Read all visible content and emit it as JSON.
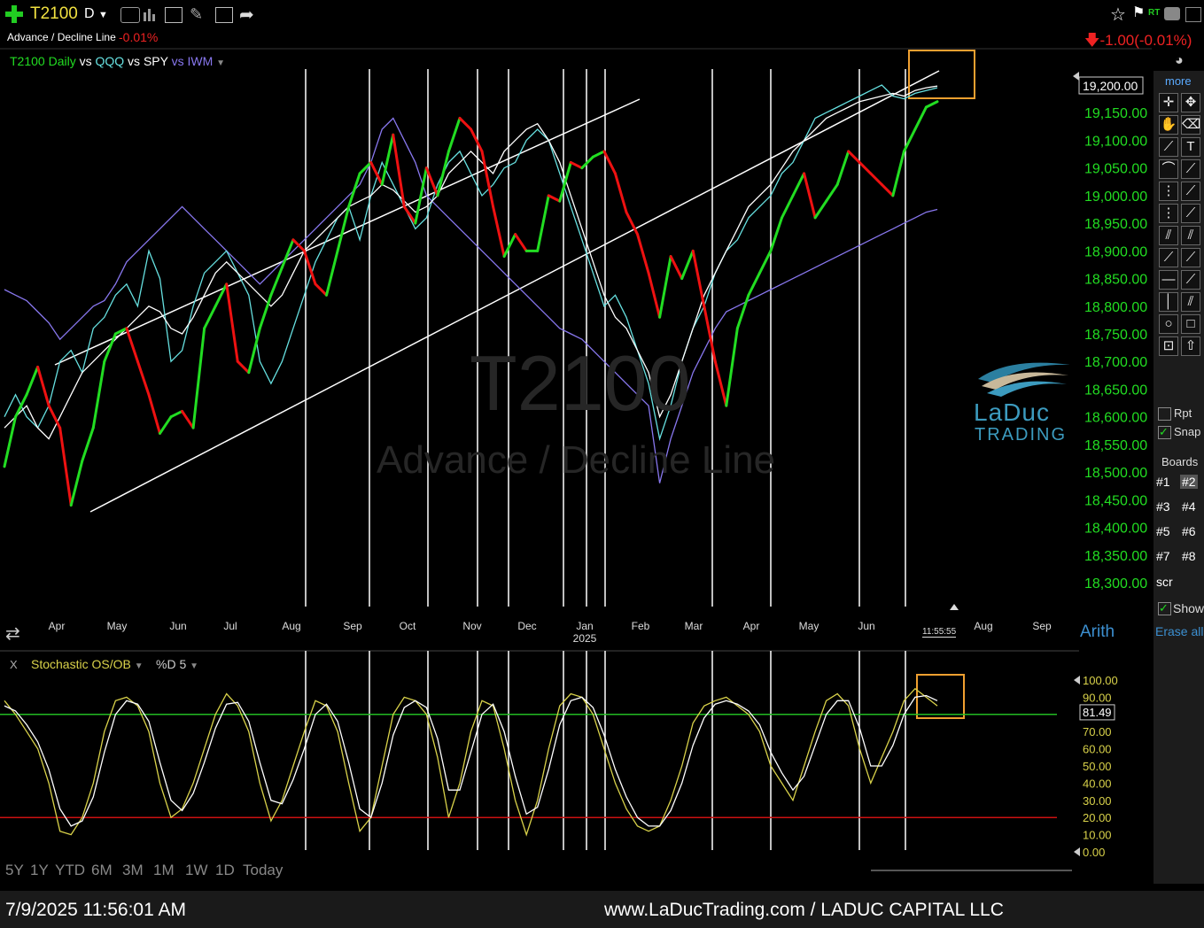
{
  "header": {
    "symbol": "T2100",
    "period": "D",
    "subtitle": "Advance / Decline Line",
    "change_pct": "-0.01%",
    "right_change": "-1.00",
    "right_change_pct": "(-0.01%)",
    "rt_label": "RT",
    "compare_line": {
      "t2100": "T2100 Daily",
      "vs1": "vs",
      "qqq": "QQQ",
      "vs2": "vs",
      "spy": "SPY",
      "vs3": "vs",
      "iwm": "IWM"
    }
  },
  "watermark": {
    "line1": "T2100",
    "line2": "Advance / Decline Line"
  },
  "logo": {
    "line1": "LaDuc",
    "line2": "TRADING"
  },
  "right_panel": {
    "more": "more",
    "rpt": "Rpt",
    "snap": "Snap",
    "boards_title": "Boards",
    "boards": [
      "#1",
      "#2",
      "#3",
      "#4",
      "#5",
      "#6",
      "#7",
      "#8"
    ],
    "scr": "scr",
    "show": "Show",
    "erase": "Erase all",
    "arith": "Arith"
  },
  "time_label": "11:55:55",
  "indicator": {
    "close": "X",
    "name": "Stochastic OS/OB",
    "param": "%D 5",
    "current": "81.49"
  },
  "ranges": [
    "5Y",
    "1Y",
    "YTD",
    "6M",
    "3M",
    "1M",
    "1W",
    "1D",
    "Today"
  ],
  "footer": {
    "datetime": "7/9/2025 11:56:01 AM",
    "site": "www.LaDucTrading.com / LADUC CAPITAL LLC"
  },
  "colors": {
    "up": "#22dd22",
    "down": "#ee1111",
    "qqq": "#66e0e0",
    "spy": "#ffffff",
    "iwm": "#8877ee",
    "stoch_k": "#d9d24a",
    "stoch_d": "#ffffff",
    "price_axis": "#22dd22"
  },
  "chart_data": [
    {
      "type": "line",
      "title": "T2100 Daily vs QQQ vs SPY vs IWM",
      "y_axis_ticks": [
        "19,150.00",
        "19,100.00",
        "19,050.00",
        "19,000.00",
        "18,950.00",
        "18,900.00",
        "18,850.00",
        "18,800.00",
        "18,750.00",
        "18,700.00",
        "18,650.00",
        "18,600.00",
        "18,550.00",
        "18,500.00",
        "18,450.00",
        "18,400.00",
        "18,350.00",
        "18,300.00"
      ],
      "last_value_label": "19,200.00",
      "ylim": [
        18300,
        19200
      ],
      "x_tick_labels": [
        "Apr",
        "May",
        "Jun",
        "Jul",
        "Aug",
        "Sep",
        "Oct",
        "Nov",
        "Dec",
        "Jan",
        "Feb",
        "Mar",
        "Apr",
        "May",
        "Jun",
        "Aug",
        "Sep"
      ],
      "x_year_label": "2025",
      "series": [
        {
          "name": "T2100",
          "values": [
            18510,
            18600,
            18640,
            18690,
            18620,
            18580,
            18440,
            18520,
            18580,
            18700,
            18750,
            18760,
            18700,
            18640,
            18570,
            18600,
            18610,
            18580,
            18760,
            18800,
            18840,
            18700,
            18680,
            18760,
            18820,
            18870,
            18920,
            18900,
            18840,
            18820,
            18900,
            18980,
            19040,
            19060,
            19020,
            19110,
            18980,
            18950,
            19050,
            19000,
            19080,
            19140,
            19120,
            19080,
            18980,
            18890,
            18930,
            18900,
            18900,
            19000,
            18990,
            19060,
            19050,
            19070,
            19080,
            19040,
            18970,
            18930,
            18860,
            18780,
            18890,
            18850,
            18900,
            18800,
            18700,
            18620,
            18760,
            18820,
            18860,
            18900,
            18960,
            19000,
            19040,
            18960,
            18990,
            19020,
            19080,
            19060,
            19040,
            19020,
            19000,
            19080,
            19120,
            19160,
            19170
          ]
        },
        {
          "name": "QQQ",
          "values": [
            18600,
            18640,
            18600,
            18580,
            18620,
            18700,
            18720,
            18680,
            18760,
            18780,
            18820,
            18840,
            18800,
            18900,
            18850,
            18700,
            18720,
            18800,
            18860,
            18880,
            18900,
            18860,
            18820,
            18700,
            18660,
            18700,
            18760,
            18820,
            18880,
            18920,
            18960,
            18980,
            18920,
            19000,
            19060,
            19020,
            18980,
            18940,
            18960,
            19020,
            19060,
            19080,
            19040,
            19000,
            19020,
            19050,
            19060,
            19100,
            19120,
            19100,
            19040,
            18980,
            18920,
            18860,
            18800,
            18820,
            18780,
            18720,
            18660,
            18560,
            18620,
            18700,
            18760,
            18800,
            18860,
            18900,
            18920,
            18960,
            18980,
            19000,
            19040,
            19060,
            19100,
            19140,
            19150,
            19160,
            19170,
            19180,
            19190,
            19200,
            19180,
            19175,
            19185,
            19190,
            19195
          ]
        },
        {
          "name": "SPY",
          "values": [
            18580,
            18600,
            18620,
            18580,
            18560,
            18600,
            18640,
            18680,
            18700,
            18720,
            18740,
            18760,
            18780,
            18800,
            18790,
            18760,
            18750,
            18780,
            18820,
            18860,
            18880,
            18860,
            18840,
            18820,
            18800,
            18820,
            18860,
            18900,
            18920,
            18940,
            18960,
            18980,
            18990,
            19000,
            19020,
            19010,
            18990,
            18970,
            18980,
            19000,
            19040,
            19060,
            19080,
            19060,
            19040,
            19080,
            19100,
            19120,
            19130,
            19100,
            19060,
            19000,
            18940,
            18880,
            18820,
            18780,
            18760,
            18720,
            18680,
            18600,
            18640,
            18700,
            18760,
            18820,
            18860,
            18900,
            18940,
            18980,
            19000,
            19020,
            19050,
            19080,
            19100,
            19120,
            19140,
            19150,
            19160,
            19170,
            19175,
            19180,
            19185,
            19180,
            19190,
            19195,
            19198
          ]
        },
        {
          "name": "IWM",
          "values": [
            18830,
            18820,
            18810,
            18790,
            18770,
            18740,
            18760,
            18780,
            18800,
            18810,
            18840,
            18880,
            18900,
            18920,
            18940,
            18960,
            18980,
            18960,
            18940,
            18920,
            18900,
            18880,
            18860,
            18840,
            18860,
            18880,
            18900,
            18920,
            18940,
            18960,
            18980,
            19000,
            19020,
            19060,
            19120,
            19140,
            19100,
            19060,
            19000,
            18980,
            18960,
            18940,
            18920,
            18900,
            18880,
            18860,
            18840,
            18820,
            18800,
            18780,
            18760,
            18750,
            18740,
            18720,
            18700,
            18680,
            18660,
            18640,
            18620,
            18480,
            18560,
            18620,
            18680,
            18720,
            18760,
            18790,
            18800,
            18810,
            18820,
            18830,
            18840,
            18850,
            18860,
            18870,
            18880,
            18890,
            18900,
            18910,
            18920,
            18930,
            18940,
            18950,
            18960,
            18970,
            18975
          ]
        }
      ]
    },
    {
      "type": "line",
      "title": "Stochastic OS/OB %D 5",
      "y_axis_ticks": [
        "100.00",
        "90.00",
        "70.00",
        "60.00",
        "50.00",
        "40.00",
        "30.00",
        "20.00",
        "10.00",
        "0.00"
      ],
      "ylim": [
        0,
        100
      ],
      "reference_lines": [
        {
          "value": 80,
          "color": "#22bb22"
        },
        {
          "value": 20,
          "color": "#cc1111"
        }
      ],
      "last_value": 81.49,
      "series": [
        {
          "name": "%K",
          "values": [
            88,
            80,
            70,
            60,
            40,
            12,
            10,
            20,
            40,
            70,
            88,
            90,
            85,
            70,
            40,
            20,
            25,
            40,
            60,
            80,
            92,
            85,
            70,
            40,
            18,
            30,
            50,
            70,
            88,
            85,
            70,
            40,
            12,
            20,
            50,
            80,
            90,
            88,
            80,
            55,
            20,
            40,
            70,
            88,
            85,
            60,
            30,
            10,
            30,
            60,
            85,
            92,
            90,
            80,
            60,
            40,
            25,
            15,
            12,
            15,
            30,
            50,
            75,
            85,
            88,
            90,
            85,
            80,
            70,
            50,
            40,
            30,
            50,
            70,
            88,
            92,
            85,
            60,
            40,
            55,
            70,
            88,
            95,
            90,
            85
          ]
        },
        {
          "name": "%D",
          "values": [
            85,
            82,
            74,
            64,
            48,
            25,
            15,
            18,
            32,
            58,
            80,
            88,
            86,
            76,
            52,
            30,
            24,
            34,
            52,
            72,
            86,
            87,
            76,
            52,
            30,
            28,
            42,
            60,
            80,
            86,
            76,
            52,
            25,
            20,
            40,
            68,
            84,
            88,
            84,
            66,
            36,
            36,
            58,
            80,
            86,
            70,
            44,
            22,
            26,
            48,
            74,
            88,
            90,
            84,
            68,
            48,
            32,
            20,
            15,
            15,
            24,
            40,
            62,
            78,
            86,
            88,
            86,
            82,
            74,
            58,
            46,
            36,
            44,
            62,
            80,
            88,
            88,
            72,
            50,
            50,
            62,
            80,
            90,
            91,
            88
          ]
        }
      ]
    }
  ]
}
